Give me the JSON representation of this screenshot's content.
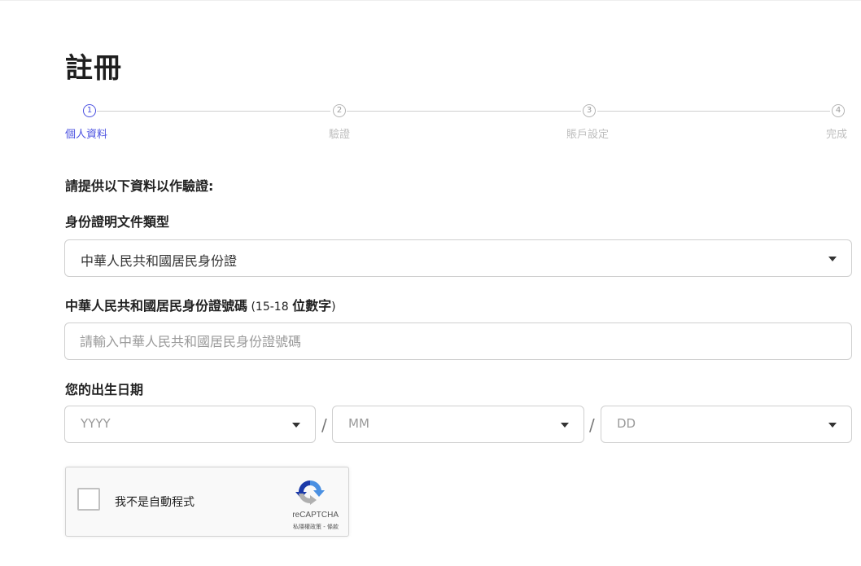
{
  "page": {
    "title": "註冊"
  },
  "stepper": {
    "steps": [
      {
        "number": "1",
        "label": "個人資料",
        "active": true
      },
      {
        "number": "2",
        "label": "驗證",
        "active": false
      },
      {
        "number": "3",
        "label": "賬戶設定",
        "active": false
      },
      {
        "number": "4",
        "label": "完成",
        "active": false
      }
    ]
  },
  "form": {
    "intro": "請提供以下資料以作驗證:",
    "id_type": {
      "label": "身份證明文件類型",
      "value": "中華人民共和國居民身份證"
    },
    "id_number": {
      "label_main": "中華人民共和國居民身份證號碼",
      "label_range": " (15-18 ",
      "label_digits": "位數字",
      "label_close": ")",
      "placeholder": "請輸入中華人民共和國居民身份證號碼",
      "value": ""
    },
    "dob": {
      "label": "您的出生日期",
      "separator": "/",
      "year_placeholder": "YYYY",
      "month_placeholder": "MM",
      "day_placeholder": "DD"
    }
  },
  "recaptcha": {
    "label": "我不是自動程式",
    "brand": "reCAPTCHA",
    "terms": "私隱權政策 - 條款",
    "checked": false
  },
  "colors": {
    "accent": "#4a50e0",
    "inactive": "#bdbdbd",
    "border": "#cfcfcf"
  },
  "icons": [
    "chevron-down-icon",
    "recaptcha-logo-icon"
  ]
}
